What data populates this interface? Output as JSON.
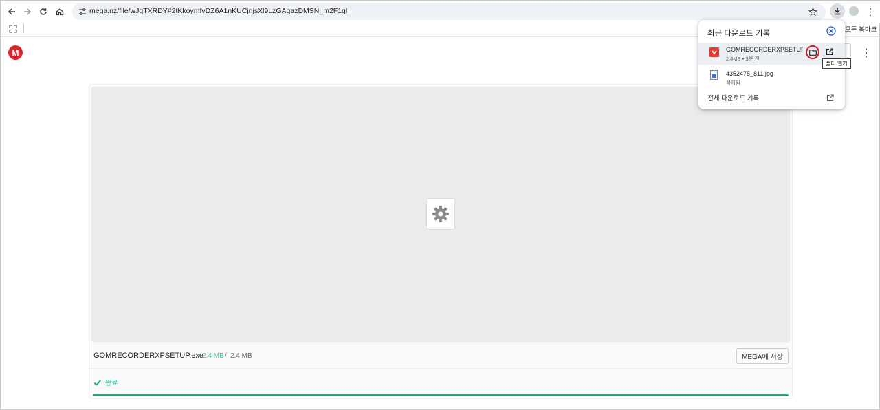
{
  "browser": {
    "url": "mega.nz/file/wJgTXRDY#2tKkoymfvDZ6A1nKUCjnjsXl9LzGAqazDMSN_m2F1ql",
    "all_bookmarks_label": "모든 북마크",
    "icons": {
      "back": "back-arrow-icon",
      "forward": "forward-arrow-icon",
      "reload": "reload-icon",
      "home": "home-icon",
      "site_info": "tune-icon",
      "bookmark": "star-icon",
      "downloads": "download-icon",
      "menu": "kebab-menu-icon",
      "apps": "apps-grid-icon"
    }
  },
  "downloads_panel": {
    "title": "최근 다운로드 기록",
    "items": [
      {
        "name": "GOMRECORDERXPSETUP.EXE",
        "meta": "2.4MB • 3분 전",
        "icon": "exe-file-icon"
      },
      {
        "name": "4352475_811.jpg",
        "meta": "삭제됨",
        "icon": "image-file-icon"
      }
    ],
    "open_folder_tooltip": "폴더 열기",
    "all_downloads_label": "전체 다운로드 기록"
  },
  "mega": {
    "logo_letter": "M",
    "brand_color": "#d9272e",
    "file": {
      "name": "GOMRECORDERXPSETUP.exe",
      "downloaded": "2.4 MB",
      "separator": "/",
      "total": "2.4 MB"
    },
    "save_button": "MEGA에 저장",
    "status": "완료",
    "progress_fraction": 1.0,
    "accent_color": "#1aab83"
  }
}
